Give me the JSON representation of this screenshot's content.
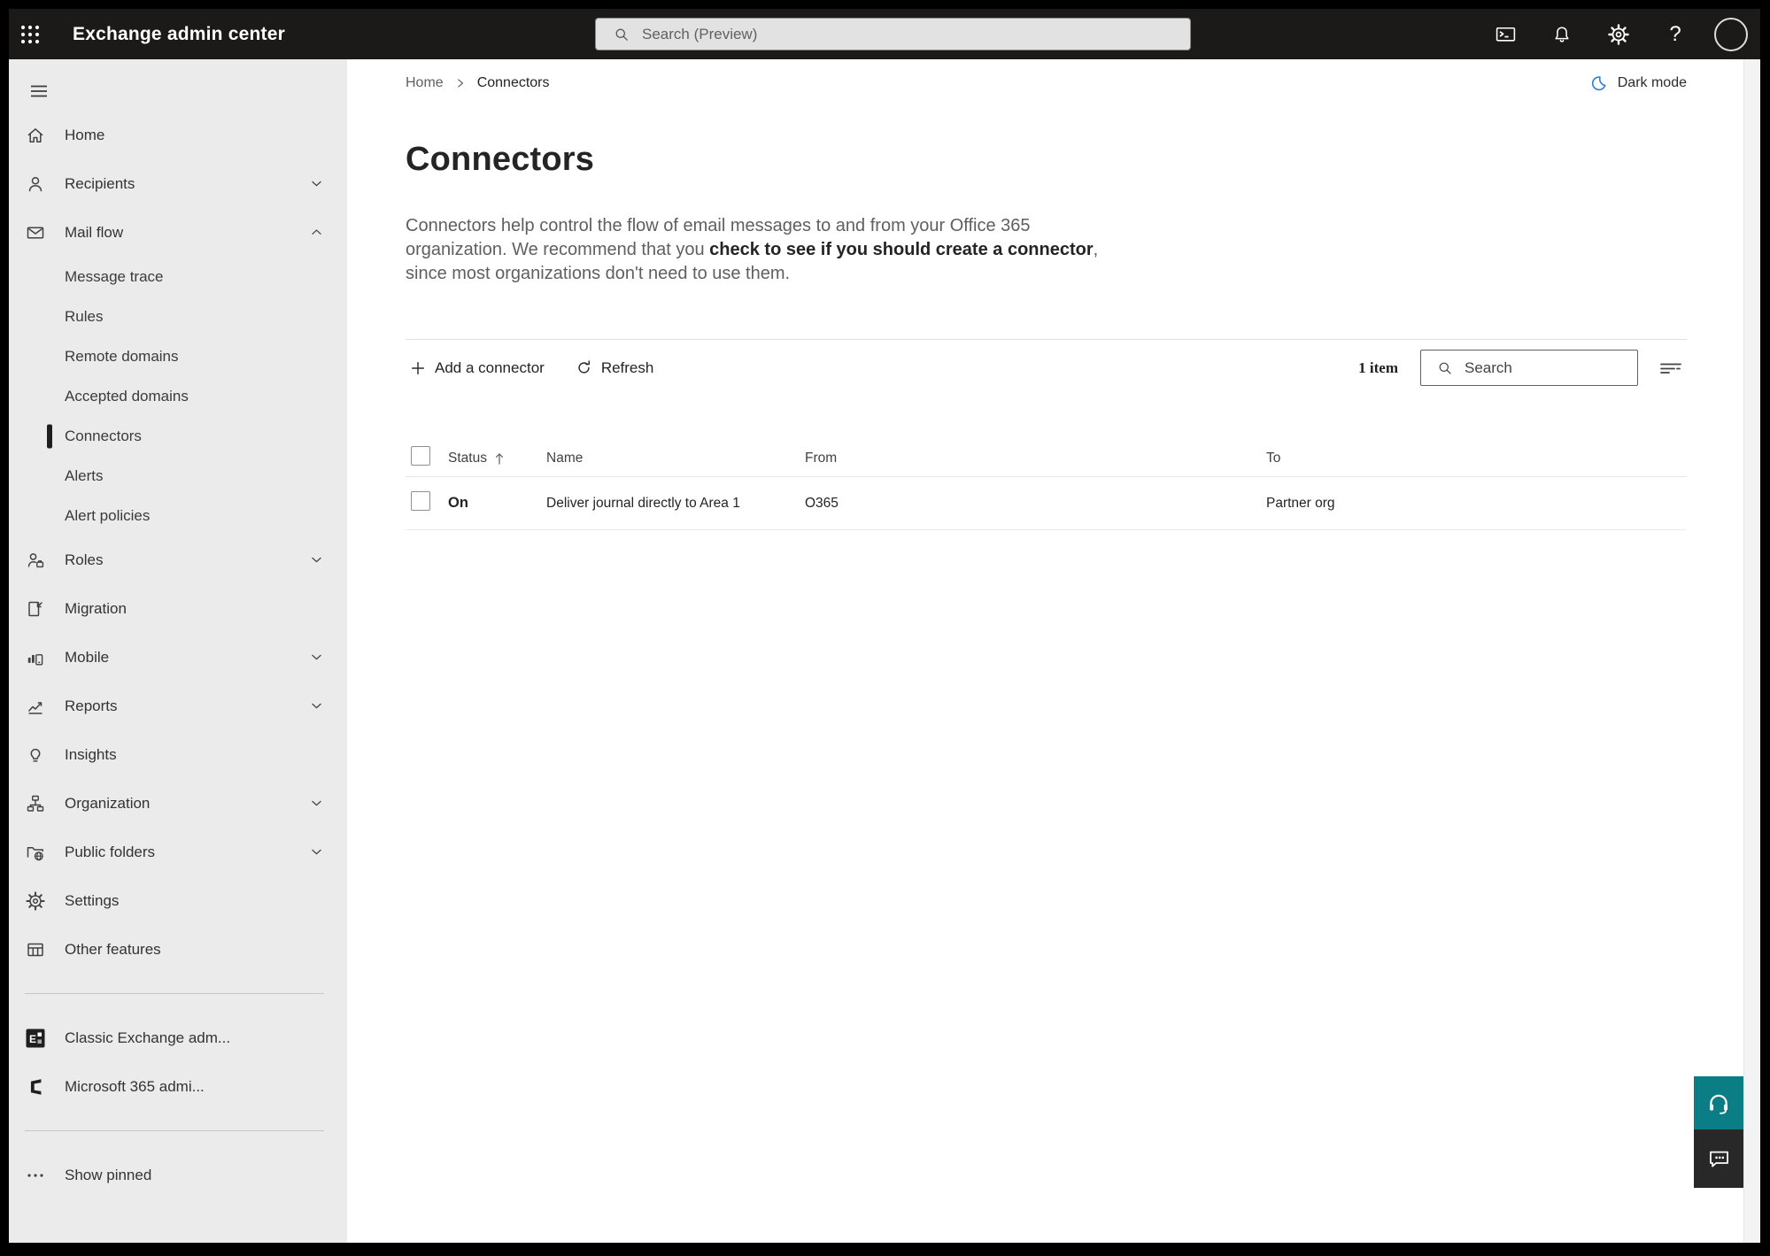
{
  "topbar": {
    "title": "Exchange admin center",
    "search_placeholder": "Search (Preview)"
  },
  "sidebar": {
    "top": [
      {
        "label": "Home"
      },
      {
        "label": "Recipients",
        "chevron": "down"
      },
      {
        "label": "Mail flow",
        "chevron": "up"
      }
    ],
    "mail_flow_children": [
      "Message trace",
      "Rules",
      "Remote domains",
      "Accepted domains",
      "Connectors",
      "Alerts",
      "Alert policies"
    ],
    "selected_child": "Connectors",
    "bottom": [
      {
        "label": "Roles",
        "chevron": "down"
      },
      {
        "label": "Migration"
      },
      {
        "label": "Mobile",
        "chevron": "down"
      },
      {
        "label": "Reports",
        "chevron": "down"
      },
      {
        "label": "Insights"
      },
      {
        "label": "Organization",
        "chevron": "down"
      },
      {
        "label": "Public folders",
        "chevron": "down"
      },
      {
        "label": "Settings"
      },
      {
        "label": "Other features"
      }
    ],
    "footer": [
      "Classic Exchange adm...",
      "Microsoft 365 admi...",
      "Show pinned"
    ]
  },
  "breadcrumb": {
    "home": "Home",
    "current": "Connectors"
  },
  "dark_mode": {
    "label": "Dark mode"
  },
  "page": {
    "title": "Connectors",
    "desc_pre": "Connectors help control the flow of email messages to and from your Office 365 organization. We recommend that you ",
    "desc_link": "check to see if you should create a connector",
    "desc_post": ", since most organizations don't need to use them."
  },
  "toolbar": {
    "add_label": "Add a connector",
    "refresh_label": "Refresh",
    "item_count": "1 item",
    "search_placeholder": "Search"
  },
  "table": {
    "headers": {
      "status": "Status",
      "name": "Name",
      "from": "From",
      "to": "To"
    },
    "row": {
      "status": "On",
      "name": "Deliver journal directly to Area 1",
      "from": "O365",
      "to": "Partner org"
    }
  },
  "colors": {
    "topbar_bg": "#1b1a19",
    "sidebar_bg": "#ebebeb",
    "accent_moon_blue": "#2e7cd6",
    "support_teal": "#0b7d84",
    "feedback_dark": "#282828"
  }
}
